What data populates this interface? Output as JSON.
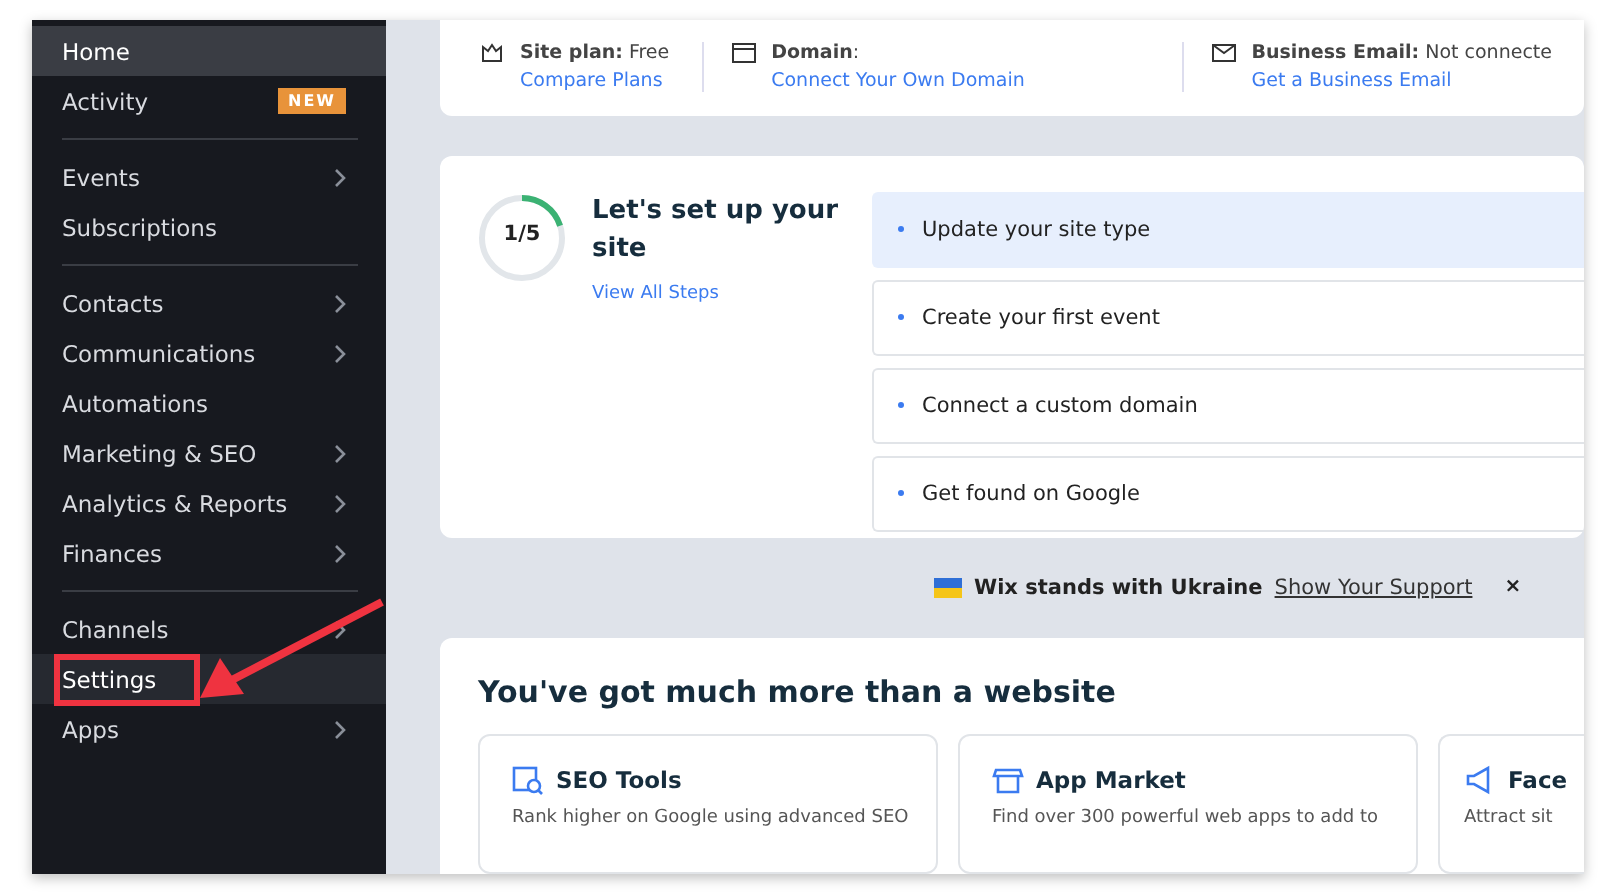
{
  "sidebar": {
    "items": [
      {
        "label": "Home",
        "selected": true,
        "hovered": false,
        "chevron": false,
        "annotated": false
      },
      {
        "label": "Activity",
        "selected": false,
        "hovered": false,
        "chevron": false,
        "annotated": false,
        "badge": "NEW"
      },
      {
        "kind": "divider"
      },
      {
        "label": "Events",
        "selected": false,
        "hovered": false,
        "chevron": true,
        "annotated": false
      },
      {
        "label": "Subscriptions",
        "selected": false,
        "hovered": false,
        "chevron": false,
        "annotated": false
      },
      {
        "kind": "divider"
      },
      {
        "label": "Contacts",
        "selected": false,
        "hovered": false,
        "chevron": true,
        "annotated": false
      },
      {
        "label": "Communications",
        "selected": false,
        "hovered": false,
        "chevron": true,
        "annotated": false
      },
      {
        "label": "Automations",
        "selected": false,
        "hovered": false,
        "chevron": false,
        "annotated": false
      },
      {
        "label": "Marketing & SEO",
        "selected": false,
        "hovered": false,
        "chevron": true,
        "annotated": false
      },
      {
        "label": "Analytics & Reports",
        "selected": false,
        "hovered": false,
        "chevron": true,
        "annotated": false
      },
      {
        "label": "Finances",
        "selected": false,
        "hovered": false,
        "chevron": true,
        "annotated": false
      },
      {
        "kind": "divider"
      },
      {
        "label": "Channels",
        "selected": false,
        "hovered": false,
        "chevron": true,
        "annotated": false
      },
      {
        "label": "Settings",
        "selected": false,
        "hovered": true,
        "chevron": false,
        "annotated": true
      },
      {
        "label": "Apps",
        "selected": false,
        "hovered": false,
        "chevron": true,
        "annotated": false
      }
    ]
  },
  "info_bar": [
    {
      "kind": "plan",
      "text": "**Site plan:** Free",
      "link": "Compare Plans"
    },
    {
      "kind": "domain",
      "text": "**Domain**:",
      "link": "Connect Your Own Domain"
    },
    {
      "kind": "email",
      "text": "**Business Email:** Not connecte",
      "link": "Get a Business Email"
    }
  ],
  "setup": {
    "progress": "1/5",
    "level": 0.2,
    "title": "Let's set up your site",
    "link": "View All Steps",
    "steps": [
      {
        "label": "Update your site type",
        "selected": true
      },
      {
        "label": "Create your first event",
        "selected": false
      },
      {
        "label": "Connect a custom domain",
        "selected": false
      },
      {
        "label": "Get found on Google",
        "selected": false
      }
    ]
  },
  "banner": {
    "text": "Wix stands with Ukraine",
    "link": "Show Your Support",
    "close": "×"
  },
  "more": {
    "title": "You've got much more than a website",
    "cards": [
      {
        "kind": "seo",
        "title": "SEO Tools",
        "text": "Rank higher on Google using advanced SEO"
      },
      {
        "kind": "market",
        "title": "App Market",
        "text": "Find over 300 powerful web apps to add to"
      },
      {
        "kind": "social",
        "title": "Face",
        "text": "Attract sit"
      }
    ]
  }
}
